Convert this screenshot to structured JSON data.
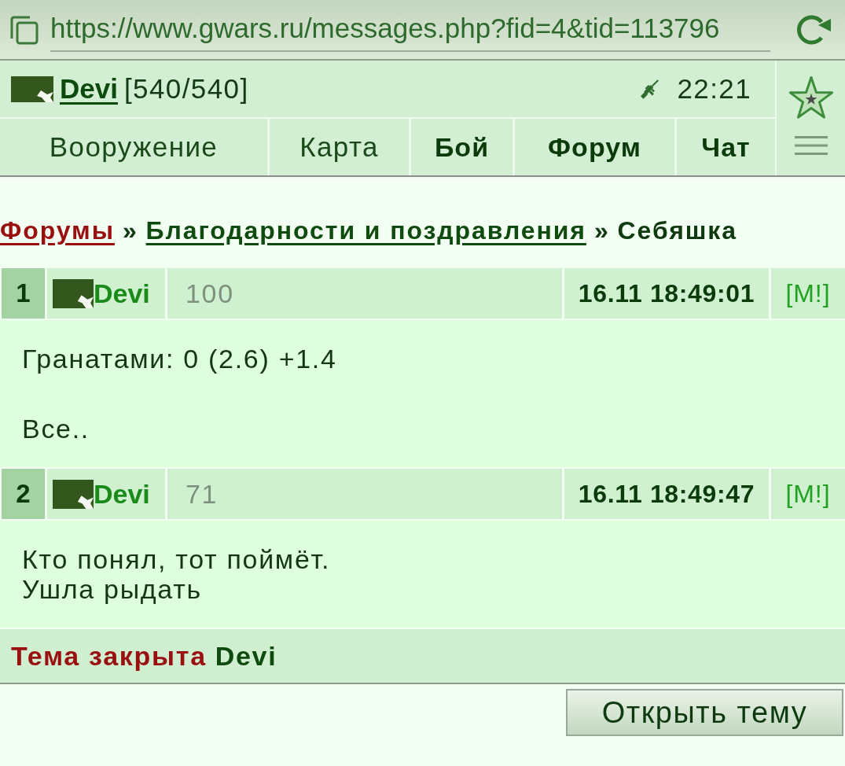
{
  "browser": {
    "url": "https://www.gwars.ru/messages.php?fid=4&tid=113796"
  },
  "header": {
    "user": {
      "name": "Devi",
      "hp": "[540/540]"
    },
    "time": "22:21",
    "nav": [
      {
        "label": "Вооружение",
        "highlighted": false
      },
      {
        "label": "Карта",
        "highlighted": false
      },
      {
        "label": "Бой",
        "highlighted": true
      },
      {
        "label": "Форум",
        "highlighted": true
      },
      {
        "label": "Чат",
        "highlighted": true
      }
    ]
  },
  "breadcrumb": [
    {
      "kind": "root",
      "label": "Форумы"
    },
    {
      "kind": "separator",
      "label": "»"
    },
    {
      "kind": "link",
      "label": "Благодарности и поздравления"
    },
    {
      "kind": "separator",
      "label": "»"
    },
    {
      "kind": "current",
      "label": "Себяшка"
    }
  ],
  "posts": [
    {
      "number": "1",
      "author": "Devi",
      "rating": "100",
      "date": "16.11 18:49:01",
      "mod_link": "[M!]",
      "paragraphs": [
        "Гранатами: 0 (2.6) +1.4",
        "Все.."
      ]
    },
    {
      "number": "2",
      "author": "Devi",
      "rating": "71",
      "date": "16.11 18:49:47",
      "mod_link": "[M!]",
      "paragraphs": [
        "Кто понял, тот поймёт.\nУшла рыдать"
      ]
    }
  ],
  "topic_status": {
    "label": "Тема закрыта",
    "by": "Devi"
  },
  "buttons": [
    {
      "label": "Открыть тему"
    }
  ]
}
